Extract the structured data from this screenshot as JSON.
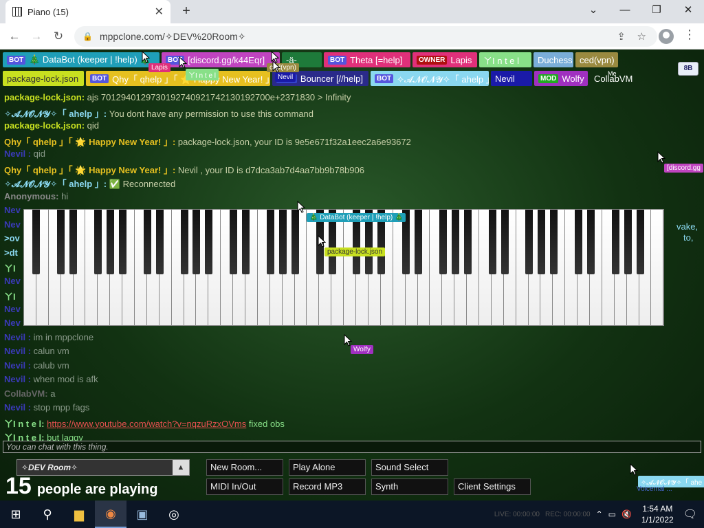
{
  "browser": {
    "tab_title": "Piano (15)",
    "url": "mppclone.com/✧DEV%20Room✧",
    "window_controls": [
      "⌄",
      "—",
      "❐",
      "✕"
    ]
  },
  "users_row1": [
    {
      "tag": "BOT",
      "tagcolor": "#5555dd",
      "name": "🎄 DataBot (keeper | !help) 🎄",
      "bg": "#1f9fb8",
      "fg": "#fff"
    },
    {
      "tag": "BOT",
      "tagcolor": "#5555dd",
      "name": "[discord.gg/k44Eqr]",
      "bg": "#c044c0",
      "fg": "#fff"
    },
    {
      "tag": "",
      "name": "-ä-",
      "bg": "#1e7a3a",
      "fg": "#fff"
    },
    {
      "tag": "BOT",
      "tagcolor": "#5555dd",
      "name": "Theta [=help]",
      "bg": "#e0307a",
      "fg": "#fff"
    },
    {
      "tag": "OWNER",
      "tagcolor": "#b01010",
      "name": "Lapis",
      "bg": "#e0307a",
      "fg": "#fff"
    },
    {
      "tag": "",
      "name": "ㄚI n t e l",
      "bg": "#88e088",
      "fg": "#fff"
    },
    {
      "tag": "",
      "name": "Duchess",
      "bg": "#7aaed8",
      "fg": "#fff"
    },
    {
      "tag": "",
      "name": "ced(vpn)",
      "bg": "#9a8a40",
      "fg": "#fff"
    }
  ],
  "users_row2": [
    {
      "tag": "",
      "name": "package-lock.json",
      "bg": "#c8e020",
      "fg": "#333"
    },
    {
      "tag": "BOT",
      "tagcolor": "#5555dd",
      "name": "Qhy「 qhelp 」「 🌟 Happy New Year! 」",
      "bg": "#e6c020",
      "fg": "#fff"
    },
    {
      "tag": "Nevil",
      "tagcolor": "#3344cc",
      "name": "Bouncer [//help]",
      "bg": "#2a2a8a",
      "fg": "#fff"
    },
    {
      "tag": "BOT",
      "tagcolor": "#5555dd",
      "name": "✧𝓐𝓝𝓞𝓝𝓨✧「 ahelp 」",
      "bg": "#8ad8f0",
      "fg": "#fff"
    },
    {
      "tag": "",
      "name": "Nevil",
      "bg": "#1a1aa8",
      "fg": "#fff"
    },
    {
      "tag": "MOD",
      "tagcolor": "#22aa22",
      "name": "Wolfy",
      "bg": "#a030c0",
      "fg": "#fff"
    },
    {
      "tag": "",
      "name": "CollabVM",
      "bg": "transparent",
      "fg": "#fff"
    }
  ],
  "me_label": "Me",
  "layout_button": "8B",
  "chat": [
    {
      "name": "package-lock.json:",
      "color": "#c8e020",
      "text": "ajs 701294012973019274092174213019270​0e+2371830 > Infinity"
    },
    {
      "name": "✧𝓐𝓝𝓞𝓝𝓨✧「 ahelp 」:",
      "color": "#8ad8f0",
      "text": "You dont have any permission to use this command"
    },
    {
      "name": "package-lock.json:",
      "color": "#c8e020",
      "text": "qid"
    },
    {
      "name": "Qhy「 qhelp 」「 🌟 Happy New Year! 」:",
      "color": "#e6c020",
      "text": "package-lock.json, your ID is 9e5e671f32a1eec2a6e93672"
    },
    {
      "name": "Nevil :",
      "color": "#3a3ab8",
      "text": "qid"
    },
    {
      "name": "Qhy「 qhelp 」「 🌟 Happy New Year! 」:",
      "color": "#e6c020",
      "text": "Nevil , your ID is d7dca3ab7d4aa7bb9b78b906"
    },
    {
      "name": "✧𝓐𝓝𝓞𝓝𝓨✧「 ahelp 」:",
      "color": "#8ad8f0",
      "text": "✅ Reconnected"
    },
    {
      "name": "Anonymous:",
      "color": "#888",
      "text": "hi"
    },
    {
      "name": "Nev",
      "color": "#3a3ab8",
      "text": ""
    },
    {
      "name": "Nev",
      "color": "#3a3ab8",
      "text": ""
    },
    {
      "name": ">ov",
      "color": "#8ad8f0",
      "text": ""
    },
    {
      "name": ">dt",
      "color": "#8ad8f0",
      "text": ""
    },
    {
      "name": "ㄚI",
      "color": "#88e088",
      "text": ""
    },
    {
      "name": "Nev",
      "color": "#3a3ab8",
      "text": ""
    },
    {
      "name": "ㄚI",
      "color": "#88e088",
      "text": ""
    },
    {
      "name": "Nev",
      "color": "#3a3ab8",
      "text": ""
    },
    {
      "name": "Nev",
      "color": "#3a3ab8",
      "text": ""
    },
    {
      "name": "Nevil :",
      "color": "#3a3ab8",
      "text": "im in mppclone"
    },
    {
      "name": "Nevil :",
      "color": "#3a3ab8",
      "text": "calun vm"
    },
    {
      "name": "Nevil :",
      "color": "#3a3ab8",
      "text": "calub vm"
    },
    {
      "name": "Nevil :",
      "color": "#3a3ab8",
      "text": "when mod is afk"
    },
    {
      "name": "CollabVM:",
      "color": "#666",
      "text": "a"
    },
    {
      "name": "Nevil :",
      "color": "#3a3ab8",
      "text": "stop mpp fags"
    },
    {
      "name": "ㄚI n t e l:",
      "color": "#88e088",
      "text": "fixed obs",
      "link": "https://www.youtube.com/watch?v=nqzuRzxOVms"
    },
    {
      "name": "ㄚI n t e l:",
      "color": "#88e088",
      "text": "but laggy"
    }
  ],
  "chat_right_fragments": [
    "vake,",
    "to,"
  ],
  "cursors": [
    {
      "label": "DataBot (keeper | !help)",
      "bg": "#1f9fb8",
      "fg": "#fff",
      "prefix": "🎄 ",
      "suffix": " 🎄"
    },
    {
      "label": "package-lock.json",
      "bg": "#c8e020",
      "fg": "#333"
    },
    {
      "label": "Wolfy",
      "bg": "#a030c0",
      "fg": "#fff"
    },
    {
      "label": "[discord.gg",
      "bg": "#c044c0",
      "fg": "#fff"
    },
    {
      "label": "Lapis",
      "bg": "#e0307a",
      "fg": "#fff"
    },
    {
      "label": "ㄚI n t e l",
      "bg": "#88e088",
      "fg": "#fff"
    },
    {
      "label": "ced(vpn)",
      "bg": "#9a8a40",
      "fg": "#fff"
    },
    {
      "label": "✧𝓐𝓝𝓞𝓝𝓨✧「 ahe",
      "bg": "#8ad8f0",
      "fg": "#fff"
    },
    {
      "label": "Nevil",
      "bg": "#1a1aa8",
      "fg": "#fff"
    }
  ],
  "chat_placeholder": "You can chat with this thing.",
  "room_name": "✧DEV Room✧",
  "people_count": "15",
  "people_text": "people are playing",
  "buttons": [
    "New Room...",
    "Play Alone",
    "Sound Select",
    "MIDI In/Out",
    "Record MP3",
    "Synth",
    "Client Settings"
  ],
  "bottom_right_fragment": "Voicemal  ...",
  "taskbar": {
    "time": "1:54 AM",
    "date": "1/1/2022",
    "live": "LIVE: 00:00:00",
    "rec": "REC: 00:00:00"
  },
  "piano": {
    "white_keys": 52
  }
}
